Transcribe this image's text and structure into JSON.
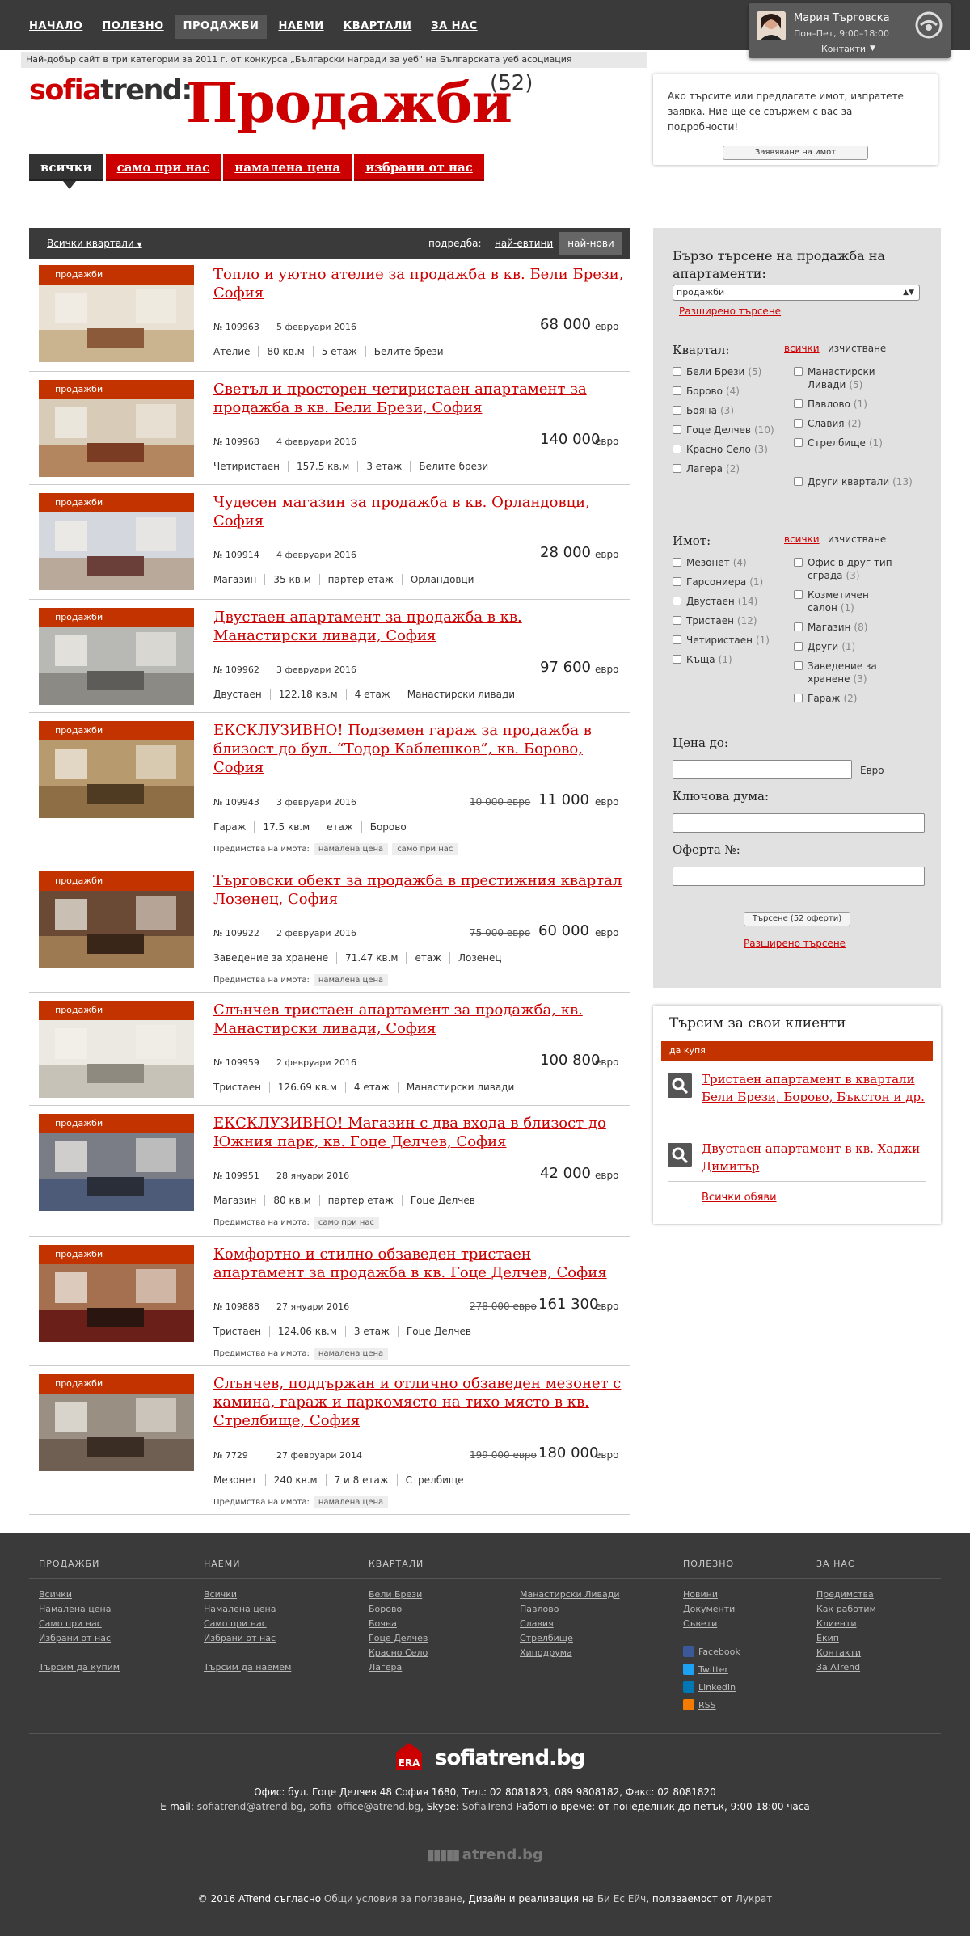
{
  "nav": [
    "НАЧАЛО",
    "ПОЛЕЗНО",
    "ПРОДАЖБИ",
    "НАЕМИ",
    "КВАРТАЛИ",
    "ЗА НАС"
  ],
  "contact": {
    "name": "Мария Търговска",
    "hours": "Пон–Пет, 9:00–18:00",
    "link": "Контакти"
  },
  "award": {
    "before": "Най-добър сайт в три категории за 2011 г. от ",
    "link": "конкурса „Български награди за уеб\"",
    "after": " на Българската уеб асоциация"
  },
  "logo": {
    "part1": "sofia",
    "part2": "trend:"
  },
  "page": {
    "title": "Продажби",
    "count": "(52)"
  },
  "tabs": [
    "всички",
    "само при нас",
    "намалена цена",
    "избрани от нас"
  ],
  "request": {
    "text": "Ако търсите или предлагате имот, изпратете заявка. Ние ще се свържем с вас за подробности!",
    "button": "Заявяване на имот"
  },
  "listbar": {
    "neighborhoods": "Всички квартали",
    "sort_label": "подредба:",
    "sort_cheap": "най-евтини",
    "sort_new": "най-нови"
  },
  "badge": "продажби",
  "currency": "евро",
  "adv_label": "Предимства на имота:",
  "listings": [
    {
      "title": "Топло и уютно ателие за продажба в кв. Бели Брези, София",
      "id": "№ 109963",
      "date": "5 февруари 2016",
      "old": "",
      "price": "68 000",
      "features": [
        "Ателие",
        "80 кв.м",
        "5 етаж",
        "Белите брези"
      ],
      "tags": []
    },
    {
      "title": "Светъл и просторен четиристаен апартамент за продажба в кв. Бели Брези, София",
      "id": "№ 109968",
      "date": "4 февруари 2016",
      "old": "",
      "price": "140 000",
      "features": [
        "Четиристаен",
        "157.5 кв.м",
        "3 етаж",
        "Белите брези"
      ],
      "tags": []
    },
    {
      "title": "Чудесен магазин за продажба в кв. Орландовци, София",
      "id": "№ 109914",
      "date": "4 февруари 2016",
      "old": "",
      "price": "28 000",
      "features": [
        "Магазин",
        "35 кв.м",
        "партер етаж",
        "Орландовци"
      ],
      "tags": []
    },
    {
      "title": "Двустаен апартамент за продажба в кв. Манастирски ливади, София",
      "id": "№ 109962",
      "date": "3 февруари 2016",
      "old": "",
      "price": "97 600",
      "features": [
        "Двустаен",
        "122.18 кв.м",
        "4 етаж",
        "Манастирски ливади"
      ],
      "tags": []
    },
    {
      "title": "ЕКСКЛУЗИВНО! Подземен гараж за продажба в близост до бул. “Тодор Каблешков”, кв. Борово, София",
      "id": "№ 109943",
      "date": "3 февруари 2016",
      "old": "10 000 евро",
      "price": "11 000",
      "features": [
        "Гараж",
        "17.5 кв.м",
        "етаж",
        "Борово"
      ],
      "tags": [
        "намалена цена",
        "само при нас"
      ]
    },
    {
      "title": "Търговски обект за продажба в престижния квартал Лозенец, София",
      "id": "№ 109922",
      "date": "2 февруари 2016",
      "old": "75 000 евро",
      "price": "60 000",
      "features": [
        "Заведение за хранене",
        "71.47 кв.м",
        "етаж",
        "Лозенец"
      ],
      "tags": [
        "намалена цена"
      ]
    },
    {
      "title": "Слънчев тристаен апартамент за продажба, кв. Манастирски ливади, София",
      "id": "№ 109959",
      "date": "2 февруари 2016",
      "old": "",
      "price": "100 800",
      "features": [
        "Тристаен",
        "126.69 кв.м",
        "4 етаж",
        "Манастирски ливади"
      ],
      "tags": []
    },
    {
      "title": "ЕКСКЛУЗИВНО! Магазин с два входа в близост до Южния парк, кв. Гоце Делчев, София",
      "id": "№ 109951",
      "date": "28 януари 2016",
      "old": "",
      "price": "42 000",
      "features": [
        "Магазин",
        "80 кв.м",
        "партер етаж",
        "Гоце Делчев"
      ],
      "tags": [
        "само при нас"
      ]
    },
    {
      "title": "Комфортно и стилно обзаведен тристаен апартамент за продажба в кв. Гоце Делчев, София",
      "id": "№ 109888",
      "date": "27 януари 2016",
      "old": "278 000 евро",
      "price": "161 300",
      "features": [
        "Тристаен",
        "124.06 кв.м",
        "3 етаж",
        "Гоце Делчев"
      ],
      "tags": [
        "намалена цена"
      ]
    },
    {
      "title": "Слънчев, поддържан и отлично обзаведен мезонет с камина, гараж и паркомясто на тихо място в кв. Стрелбище, София",
      "id": "№ 7729",
      "date": "27 февруари 2014",
      "old": "199 000 евро",
      "price": "180 000",
      "features": [
        "Мезонет",
        "240 кв.м",
        "7 и 8 етаж",
        "Стрелбище"
      ],
      "tags": [
        "намалена цена"
      ]
    }
  ],
  "search": {
    "title": "Бързо търсене на продажба на апартаменти:",
    "type": "продажби",
    "advanced": "Разширено търсене",
    "all": "всички",
    "clear": "изчистване",
    "district_label": "Квартал:",
    "districts_left": [
      {
        "n": "Бели Брези",
        "c": "(5)"
      },
      {
        "n": "Борово",
        "c": "(4)"
      },
      {
        "n": "Бояна",
        "c": "(3)"
      },
      {
        "n": "Гоце Делчев",
        "c": "(10)"
      },
      {
        "n": "Красно Село",
        "c": "(3)"
      },
      {
        "n": "Лагера",
        "c": "(2)"
      }
    ],
    "districts_right": [
      {
        "n": "Манастирски Ливади",
        "c": "(5)"
      },
      {
        "n": "Павлово",
        "c": "(1)"
      },
      {
        "n": "Славия",
        "c": "(2)"
      },
      {
        "n": "Стрелбище",
        "c": "(1)"
      },
      {
        "n": "Други квартали",
        "c": "(13)"
      }
    ],
    "property_label": "Имот:",
    "props_left": [
      {
        "n": "Мезонет",
        "c": "(4)"
      },
      {
        "n": "Гарсониера",
        "c": "(1)"
      },
      {
        "n": "Двустаен",
        "c": "(14)"
      },
      {
        "n": "Тристаен",
        "c": "(12)"
      },
      {
        "n": "Четиристаен",
        "c": "(1)"
      },
      {
        "n": "Къща",
        "c": "(1)"
      }
    ],
    "props_right": [
      {
        "n": "Офис в друг тип сграда",
        "c": "(3)"
      },
      {
        "n": "Козметичен салон",
        "c": "(1)"
      },
      {
        "n": "Магазин",
        "c": "(8)"
      },
      {
        "n": "Други",
        "c": "(1)"
      },
      {
        "n": "Заведение за хранене",
        "c": "(3)"
      },
      {
        "n": "Гараж",
        "c": "(2)"
      }
    ],
    "price_label": "Цена до:",
    "euro": "Евро",
    "keyword_label": "Ключова дума:",
    "offer_label": "Оферта №:",
    "button": "Търсене (52 оферти)"
  },
  "clients": {
    "title": "Търсим за свои клиенти",
    "bar": "да купя",
    "items": [
      "Тристаен апартамент в квартали Бели Брези, Борово, Бъкстон и др.",
      "Двустаен апартамент в кв. Хаджи Димитър"
    ],
    "all": "Всички обяви"
  },
  "footer": {
    "heads": [
      "ПРОДАЖБИ",
      "НАЕМИ",
      "КВАРТАЛИ",
      "ПОЛЕЗНО",
      "ЗА НАС"
    ],
    "sales": [
      "Всички",
      "Намалена цена",
      "Само при нас",
      "Избрани от нас",
      "Търсим да купим"
    ],
    "rents": [
      "Всички",
      "Намалена цена",
      "Само при нас",
      "Избрани от нас",
      "Търсим да наемем"
    ],
    "districts1": [
      "Бели Брези",
      "Борово",
      "Бояна",
      "Гоце Делчев",
      "Красно Село",
      "Лагера"
    ],
    "districts2": [
      "Манастирски Ливади",
      "Павлово",
      "Славия",
      "Стрелбище",
      "Хиподрума"
    ],
    "useful": [
      "Новини",
      "Документи",
      "Съвети"
    ],
    "social": [
      "Facebook",
      "Twitter",
      "LinkedIn",
      "RSS"
    ],
    "about": [
      "Предимства",
      "Как работим",
      "Клиенти",
      "Екип",
      "Контакти",
      "За ATrend"
    ],
    "brand": "sofiatrend.bg",
    "office": "Офис: бул. Гоце Делчев 48 София 1680, Тел.: 02 8081823, 089 9808182, Факс: 02 8081820",
    "email_label": "E-mail: ",
    "email1": "sofiatrend@atrend.bg",
    "email2": "sofia_office@atrend.bg",
    "skype_label": ", Skype: ",
    "skype": "SofiaTrend",
    "hours": " Работно време: от понеделник до петък, 9:00-18:00 часа",
    "atrend": "atrend.bg",
    "copy1": "© 2016 ATrend съгласно ",
    "copy_terms": "Общи условия за ползване",
    "copy2": ", Дизайн и реализация на ",
    "copy_des": "Би Ес Ейч",
    "copy3": ", ползваемост от ",
    "copy_ux": "Лукрат"
  },
  "colors": {
    "accent": "#cc0000",
    "dark": "#3a3a3a",
    "badge": "#c33300"
  }
}
